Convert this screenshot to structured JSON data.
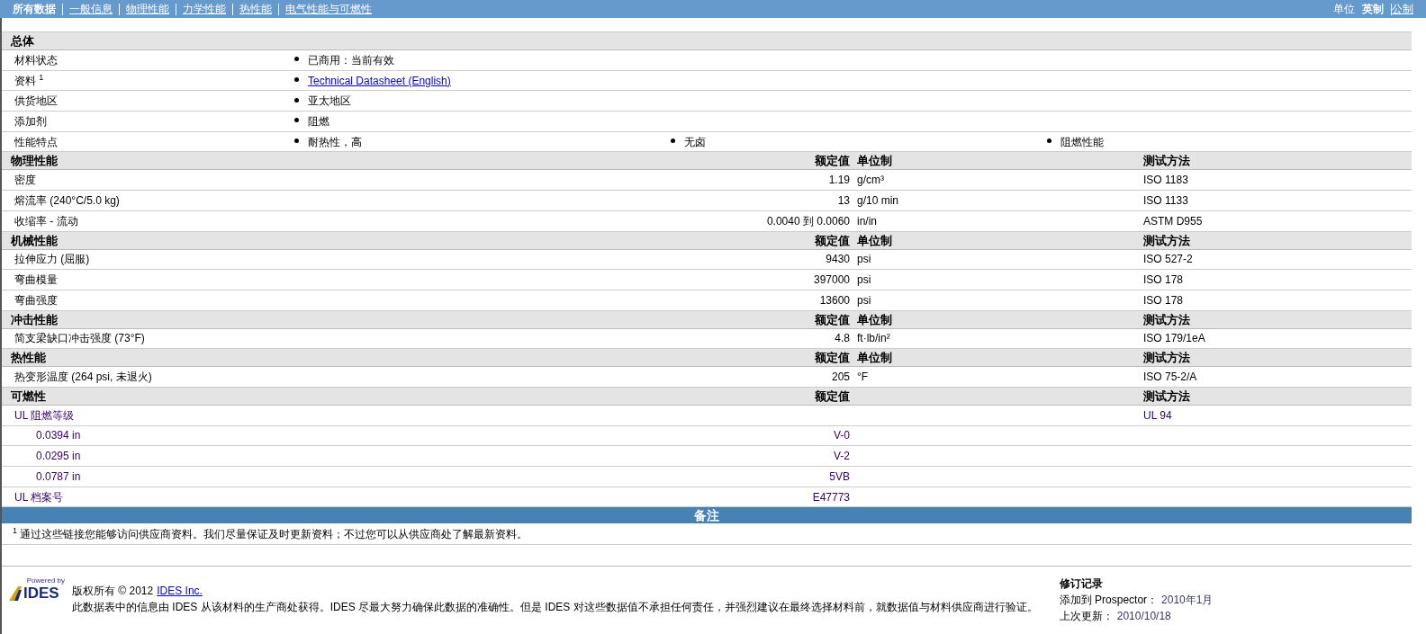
{
  "nav": {
    "tabs": [
      {
        "label": "所有数据",
        "selected": true
      },
      {
        "label": "一般信息",
        "selected": false
      },
      {
        "label": "物理性能",
        "selected": false
      },
      {
        "label": "力学性能",
        "selected": false
      },
      {
        "label": "热性能",
        "selected": false
      },
      {
        "label": "电气性能与可燃性",
        "selected": false
      }
    ],
    "units": {
      "label": "单位",
      "options": [
        {
          "label": "英制",
          "selected": true
        },
        {
          "label": "公制",
          "selected": false
        }
      ]
    }
  },
  "general": {
    "title": "总体",
    "rows": [
      {
        "name": "材料状态",
        "values": [
          {
            "kind": "text",
            "text": "已商用：当前有效"
          }
        ]
      },
      {
        "name": "资料 $^{1}$",
        "values": [
          {
            "kind": "link",
            "text": "Technical Datasheet (English)"
          }
        ]
      },
      {
        "name": "供货地区",
        "values": [
          {
            "kind": "text",
            "text": "亚太地区"
          }
        ]
      },
      {
        "name": "添加剂",
        "values": [
          {
            "kind": "text",
            "text": "阻燃"
          }
        ]
      },
      {
        "name": "性能特点",
        "values": [
          {
            "kind": "text",
            "text": "耐热性，高"
          },
          {
            "kind": "text",
            "text": "无卤"
          },
          {
            "kind": "text",
            "text": "阻燃性能"
          }
        ]
      }
    ]
  },
  "sections": [
    {
      "title": "物理性能",
      "kind": "plain",
      "headers": {
        "value": "额定值",
        "unit": "单位制",
        "method": "测试方法"
      },
      "rows": [
        {
          "name": "密度",
          "value": "1.19",
          "unit": "g/cm³",
          "method": "ISO 1183"
        },
        {
          "name": "熔流率 (240°C/5.0 kg)",
          "value": "13",
          "unit": "g/10 min",
          "method": "ISO 1133"
        },
        {
          "name": "收缩率 - 流动",
          "value": "0.0040 到 0.0060",
          "unit": "in/in",
          "method": "ASTM D955"
        }
      ]
    },
    {
      "title": "机械性能",
      "kind": "plain",
      "headers": {
        "value": "额定值",
        "unit": "单位制",
        "method": "测试方法"
      },
      "rows": [
        {
          "name": "拉伸应力 (屈服)",
          "value": "9430",
          "unit": "psi",
          "method": "ISO 527-2"
        },
        {
          "name": "弯曲模量",
          "value": "397000",
          "unit": "psi",
          "method": "ISO 178"
        },
        {
          "name": "弯曲强度",
          "value": "13600",
          "unit": "psi",
          "method": "ISO 178"
        }
      ]
    },
    {
      "title": "冲击性能",
      "kind": "plain",
      "headers": {
        "value": "额定值",
        "unit": "单位制",
        "method": "测试方法"
      },
      "rows": [
        {
          "name": "简支梁缺口冲击强度 (73°F)",
          "value": "4.8",
          "unit": "ft·lb/in²",
          "method": "ISO 179/1eA"
        }
      ]
    },
    {
      "title": "热性能",
      "kind": "plain",
      "headers": {
        "value": "额定值",
        "unit": "单位制",
        "method": "测试方法"
      },
      "rows": [
        {
          "name": "热变形温度 (264 psi, 未退火)",
          "value": "205",
          "unit": "°F",
          "method": "ISO 75-2/A"
        }
      ]
    },
    {
      "title": "可燃性",
      "kind": "rating",
      "headers": {
        "value": "额定值",
        "method": "测试方法"
      },
      "rows": [
        {
          "name": "UL 阻燃等级",
          "method": "UL 94",
          "children": [
            {
              "name": "0.0394 in",
              "value": "V-0"
            },
            {
              "name": "0.0295 in",
              "value": "V-2"
            },
            {
              "name": "0.0787 in",
              "value": "5VB"
            }
          ]
        },
        {
          "name": "UL 档案号",
          "value": "E47773"
        }
      ]
    }
  ],
  "notes": {
    "title": "备注",
    "footnotes": [
      {
        "mark": "1",
        "text": "通过这些链接您能够访问供应商资料。我们尽量保证及时更新资料；不过您可以从供应商处了解最新资料。"
      }
    ]
  },
  "footer": {
    "logo": {
      "tagline": "Powered by",
      "name": "IDES"
    },
    "copyright": "版权所有 © 2012",
    "company_link": "IDES Inc.",
    "disclaimer": "此数据表中的信息由 IDES 从该材料的生产商处获得。IDES 尽最大努力确保此数据的准确性。但是 IDES 对这些数据值不承担任何责任，并强烈建议在最终选择材料前，就数据值与材料供应商进行验证。",
    "revision": {
      "title": "修订记录",
      "lines": [
        {
          "label": "添加到 Prospector：",
          "value": "2010年1月"
        },
        {
          "label": "上次更新：",
          "value": "2010/10/18"
        }
      ]
    }
  }
}
